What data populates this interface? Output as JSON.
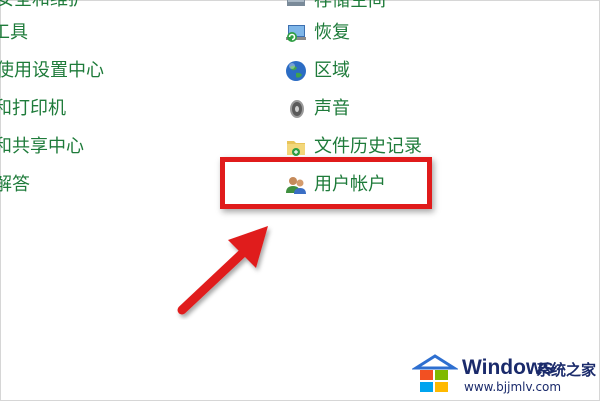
{
  "left_column": [
    {
      "label": "安全和维护"
    },
    {
      "label": "工具"
    },
    {
      "label": "使用设置中心"
    },
    {
      "label": "和打印机"
    },
    {
      "label": "和共享中心"
    },
    {
      "label": "解答"
    }
  ],
  "right_column": [
    {
      "label": "存储空间",
      "icon": "storage-icon"
    },
    {
      "label": "恢复",
      "icon": "recovery-icon"
    },
    {
      "label": "区域",
      "icon": "region-globe-icon"
    },
    {
      "label": "声音",
      "icon": "speaker-icon"
    },
    {
      "label": "文件历史记录",
      "icon": "file-history-icon"
    },
    {
      "label": "用户帐户",
      "icon": "user-accounts-icon"
    }
  ],
  "highlight": {
    "target": "用户帐户",
    "color": "#e01b1b"
  },
  "watermark": {
    "brand": "Windows",
    "chinese": "系统之家",
    "url": "www.bjjmlv.com"
  },
  "colors": {
    "link_green": "#1e7b3a",
    "highlight_red": "#e01b1b",
    "watermark_blue": "#1a2a6b"
  }
}
